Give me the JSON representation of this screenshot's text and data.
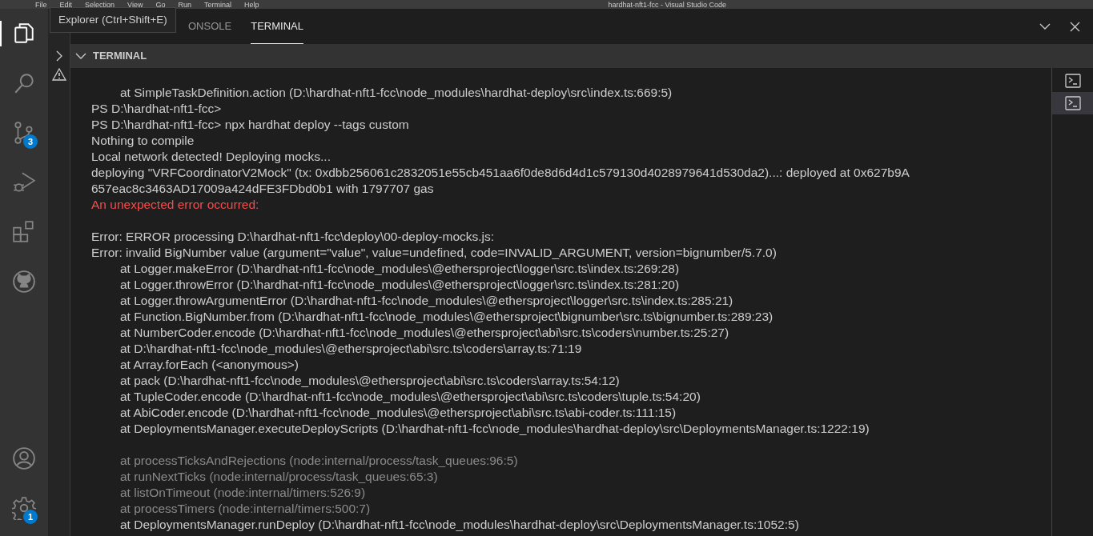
{
  "window": {
    "menu": [
      "File",
      "Edit",
      "Selection",
      "View",
      "Go",
      "Run",
      "Terminal",
      "Help"
    ],
    "title": "hardhat-nft1-fcc - Visual Studio Code"
  },
  "activity_bar": {
    "items": [
      {
        "kind": "files",
        "selected": true
      },
      {
        "kind": "search",
        "selected": false
      },
      {
        "kind": "source-control",
        "selected": false,
        "badge": "3"
      },
      {
        "kind": "run",
        "selected": false
      },
      {
        "kind": "extensions",
        "selected": false
      },
      {
        "kind": "github",
        "selected": false
      }
    ],
    "bottom": [
      {
        "kind": "account"
      },
      {
        "kind": "settings",
        "badge": "1"
      }
    ]
  },
  "tooltip": "Explorer (Ctrl+Shift+E)",
  "panel": {
    "tabs": [
      {
        "label": "ONSOLE",
        "selected": false
      },
      {
        "label": "TERMINAL",
        "selected": true
      }
    ],
    "section_title": "TERMINAL",
    "lines": [
      {
        "kind": "trace",
        "text": "at SimpleTaskDefinition.action (D:\\hardhat-nft1-fcc\\node_modules\\hardhat-deploy\\src\\index.ts:669:5)"
      },
      {
        "kind": "plain",
        "text": "PS D:\\hardhat-nft1-fcc>"
      },
      {
        "kind": "plain",
        "text": "PS D:\\hardhat-nft1-fcc> npx hardhat deploy --tags custom"
      },
      {
        "kind": "plain",
        "text": "Nothing to compile"
      },
      {
        "kind": "plain",
        "text": "Local network detected! Deploying mocks..."
      },
      {
        "kind": "plain",
        "text": "deploying \"VRFCoordinatorV2Mock\" (tx: 0xdbb256061c2832051e55cb451aa6f0de8d6d4d1c579130d4028979641d530da2)...: deployed at 0x627b9A"
      },
      {
        "kind": "plain",
        "text": "657eac8c3463AD17009a424dFE3FDbd0b1 with 1797707 gas"
      },
      {
        "kind": "error",
        "text": "An unexpected error occurred:"
      },
      {
        "kind": "blank"
      },
      {
        "kind": "plain",
        "text": "Error: ERROR processing D:\\hardhat-nft1-fcc\\deploy\\00-deploy-mocks.js:"
      },
      {
        "kind": "plain",
        "text": "Error: invalid BigNumber value (argument=\"value\", value=undefined, code=INVALID_ARGUMENT, version=bignumber/5.7.0)"
      },
      {
        "kind": "trace",
        "text": "at Logger.makeError (D:\\hardhat-nft1-fcc\\node_modules\\@ethersproject\\logger\\src.ts\\index.ts:269:28)"
      },
      {
        "kind": "trace",
        "text": "at Logger.throwError (D:\\hardhat-nft1-fcc\\node_modules\\@ethersproject\\logger\\src.ts\\index.ts:281:20)"
      },
      {
        "kind": "trace",
        "text": "at Logger.throwArgumentError (D:\\hardhat-nft1-fcc\\node_modules\\@ethersproject\\logger\\src.ts\\index.ts:285:21)"
      },
      {
        "kind": "trace",
        "text": "at Function.BigNumber.from (D:\\hardhat-nft1-fcc\\node_modules\\@ethersproject\\bignumber\\src.ts\\bignumber.ts:289:23)"
      },
      {
        "kind": "trace",
        "text": "at NumberCoder.encode (D:\\hardhat-nft1-fcc\\node_modules\\@ethersproject\\abi\\src.ts\\coders\\number.ts:25:27)"
      },
      {
        "kind": "trace",
        "text": "at D:\\hardhat-nft1-fcc\\node_modules\\@ethersproject\\abi\\src.ts\\coders\\array.ts:71:19"
      },
      {
        "kind": "trace",
        "text": "at Array.forEach (<anonymous>)"
      },
      {
        "kind": "trace",
        "text": "at pack (D:\\hardhat-nft1-fcc\\node_modules\\@ethersproject\\abi\\src.ts\\coders\\array.ts:54:12)"
      },
      {
        "kind": "trace",
        "text": "at TupleCoder.encode (D:\\hardhat-nft1-fcc\\node_modules\\@ethersproject\\abi\\src.ts\\coders\\tuple.ts:54:20)"
      },
      {
        "kind": "trace",
        "text": "at AbiCoder.encode (D:\\hardhat-nft1-fcc\\node_modules\\@ethersproject\\abi\\src.ts\\abi-coder.ts:111:15)"
      },
      {
        "kind": "trace",
        "text": "at DeploymentsManager.executeDeployScripts (D:\\hardhat-nft1-fcc\\node_modules\\hardhat-deploy\\src\\DeploymentsManager.ts:1222:19)"
      },
      {
        "kind": "blank"
      },
      {
        "kind": "dim",
        "text": "at processTicksAndRejections (node:internal/process/task_queues:96:5)"
      },
      {
        "kind": "dim",
        "text": "at runNextTicks (node:internal/process/task_queues:65:3)"
      },
      {
        "kind": "dim",
        "text": "at listOnTimeout (node:internal/timers:526:9)"
      },
      {
        "kind": "dim",
        "text": "at processTimers (node:internal/timers:500:7)"
      },
      {
        "kind": "trace",
        "text": "at DeploymentsManager.runDeploy (D:\\hardhat-nft1-fcc\\node_modules\\hardhat-deploy\\src\\DeploymentsManager.ts:1052:5)"
      }
    ],
    "terminals": [
      {
        "selected": false
      },
      {
        "selected": true
      }
    ]
  }
}
